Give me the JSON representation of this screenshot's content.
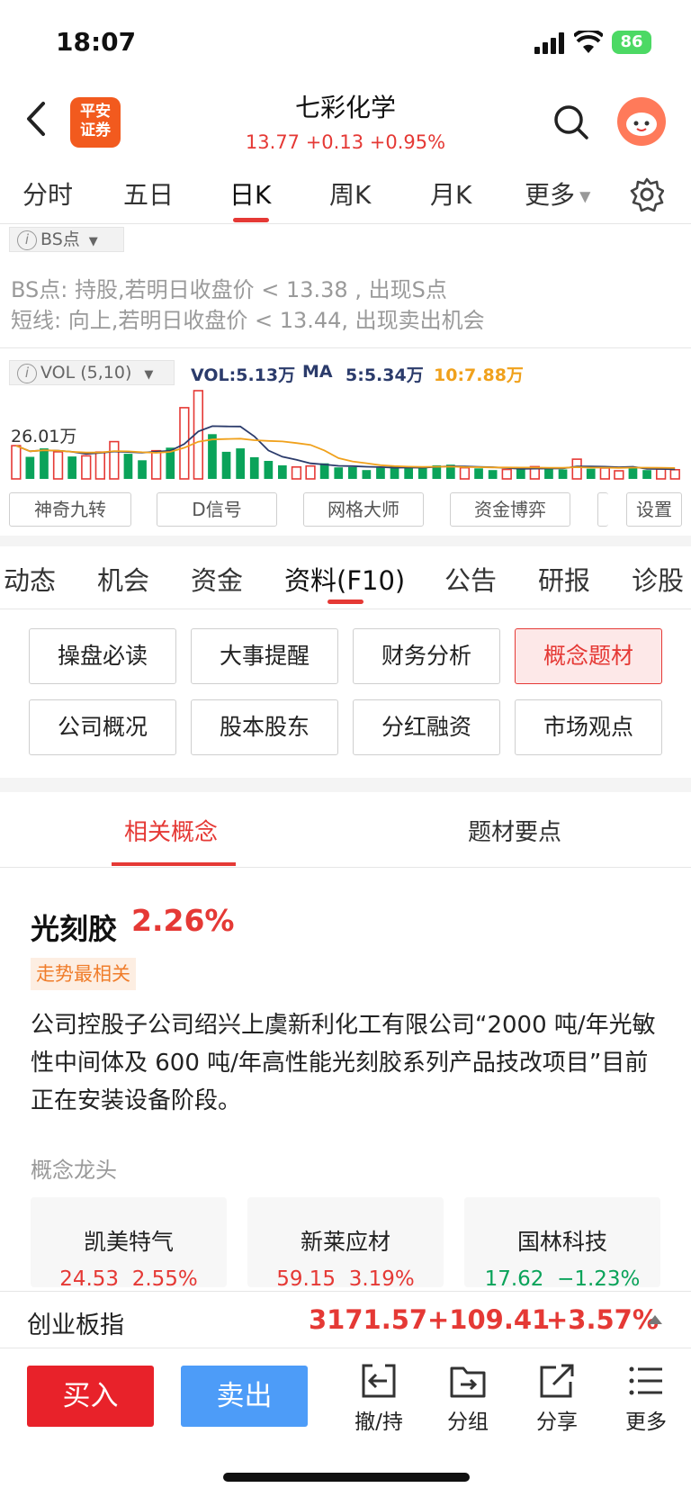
{
  "status": {
    "time": "18:07",
    "battery": "86"
  },
  "header": {
    "broker_logo": "平安\n证券",
    "stock_name": "七彩化学",
    "quote": "13.77 +0.13 +0.95%",
    "colors": {
      "up": "#e53935",
      "down": "#0aa35a",
      "accent": "#e53935"
    }
  },
  "period_tabs": [
    "分时",
    "五日",
    "日K",
    "周K",
    "月K",
    "更多"
  ],
  "bs": {
    "chip": "BS点",
    "line1": "BS点: 持股,若明日收盘价 < 13.38 , 出现S点",
    "line2": " 短线: 向上,若明日收盘价 < 13.44, 出现卖出机会"
  },
  "vol": {
    "chip": "VOL (5,10)",
    "vol_text": "VOL:5.13万",
    "ma_label": "MA",
    "ma5_text": "5:5.34万",
    "ma10_text": "10:7.88万",
    "max_label": "26.01万"
  },
  "chart_data": {
    "type": "bar",
    "title": "",
    "xlabel": "",
    "ylabel": "",
    "ylim": [
      0,
      26.01
    ],
    "unit": "万",
    "bars": [
      {
        "v": 9.8,
        "up": true
      },
      {
        "v": 6.5,
        "up": false
      },
      {
        "v": 9.0,
        "up": false
      },
      {
        "v": 8.0,
        "up": true
      },
      {
        "v": 6.6,
        "up": false
      },
      {
        "v": 6.8,
        "up": true
      },
      {
        "v": 7.9,
        "up": true
      },
      {
        "v": 11.0,
        "up": true
      },
      {
        "v": 7.4,
        "up": false
      },
      {
        "v": 5.5,
        "up": false
      },
      {
        "v": 8.3,
        "up": true
      },
      {
        "v": 9.2,
        "up": false
      },
      {
        "v": 21.0,
        "up": true
      },
      {
        "v": 26.0,
        "up": true
      },
      {
        "v": 13.2,
        "up": false
      },
      {
        "v": 8.0,
        "up": false
      },
      {
        "v": 9.0,
        "up": false
      },
      {
        "v": 6.4,
        "up": false
      },
      {
        "v": 5.3,
        "up": false
      },
      {
        "v": 4.0,
        "up": false
      },
      {
        "v": 3.5,
        "up": true
      },
      {
        "v": 3.8,
        "up": true
      },
      {
        "v": 4.6,
        "up": false
      },
      {
        "v": 3.4,
        "up": false
      },
      {
        "v": 3.5,
        "up": false
      },
      {
        "v": 2.6,
        "up": false
      },
      {
        "v": 3.3,
        "up": false
      },
      {
        "v": 3.6,
        "up": false
      },
      {
        "v": 3.7,
        "up": false
      },
      {
        "v": 3.2,
        "up": false
      },
      {
        "v": 4.0,
        "up": false
      },
      {
        "v": 4.2,
        "up": false
      },
      {
        "v": 3.3,
        "up": true
      },
      {
        "v": 3.1,
        "up": false
      },
      {
        "v": 2.6,
        "up": false
      },
      {
        "v": 2.8,
        "up": true
      },
      {
        "v": 3.0,
        "up": false
      },
      {
        "v": 3.6,
        "up": true
      },
      {
        "v": 3.2,
        "up": false
      },
      {
        "v": 2.8,
        "up": false
      },
      {
        "v": 5.8,
        "up": true
      },
      {
        "v": 3.0,
        "up": false
      },
      {
        "v": 3.2,
        "up": true
      },
      {
        "v": 2.4,
        "up": true
      },
      {
        "v": 3.5,
        "up": false
      },
      {
        "v": 2.6,
        "up": false
      },
      {
        "v": 2.9,
        "up": true
      },
      {
        "v": 2.7,
        "up": true
      }
    ]
  },
  "tools": [
    "神奇九转",
    "D信号",
    "网格大师",
    "资金博弈",
    "设置"
  ],
  "section_tabs": [
    "动态",
    "机会",
    "资金",
    "资料(F10)",
    "公告",
    "研报",
    "诊股"
  ],
  "grid_buttons": [
    "操盘必读",
    "大事提醒",
    "财务分析",
    "概念题材",
    "公司概况",
    "股本股东",
    "分红融资",
    "市场观点"
  ],
  "concept_tabs": [
    "相关概念",
    "题材要点"
  ],
  "concept": {
    "name": "光刻胶",
    "pct": "2.26%",
    "badge": "走势最相关",
    "desc": "公司控股子公司绍兴上虞新利化工有限公司“2000 吨/年光敏性中间体及 600 吨/年高性能光刻胶系列产品技改项目”目前正在安装设备阶段。",
    "leaders_title": "概念龙头",
    "leaders": [
      {
        "name": "凯美特气",
        "price": "24.53",
        "chg": "2.55%"
      },
      {
        "name": "新莱应材",
        "price": "59.15",
        "chg": "3.19%"
      },
      {
        "name": "国林科技",
        "price": "17.62",
        "chg": "−1.23%"
      }
    ]
  },
  "index": {
    "name": "创业板指",
    "value": "3171.57",
    "change": "+109.41",
    "pct": "+3.57%"
  },
  "bottom": {
    "buy": "买入",
    "sell": "卖出",
    "actions": [
      "撤/持",
      "分组",
      "分享",
      "更多"
    ]
  }
}
